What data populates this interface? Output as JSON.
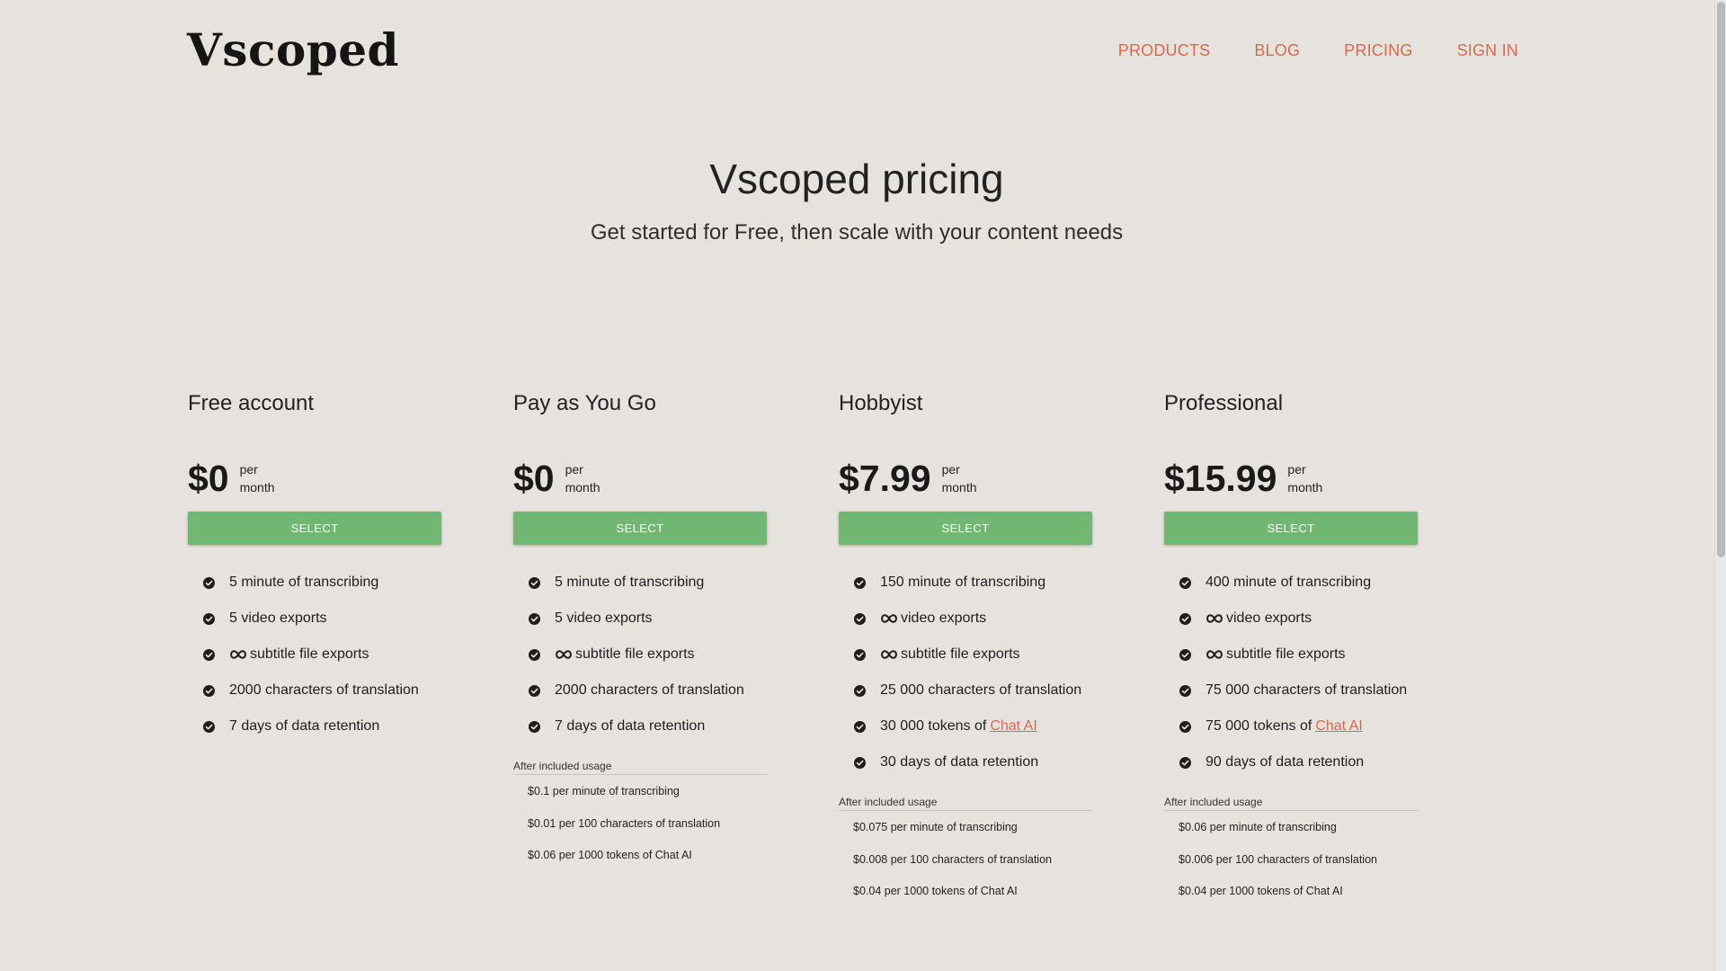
{
  "header": {
    "logo": "Vscoped",
    "nav": [
      "PRODUCTS",
      "BLOG",
      "PRICING",
      "SIGN IN"
    ]
  },
  "hero": {
    "title": "Vscoped pricing",
    "subtitle": "Get started for Free, then scale with your content needs"
  },
  "plans": [
    {
      "name": "Free account",
      "price": "$0",
      "per_1": "per",
      "per_2": "month",
      "select": "SELECT",
      "features": [
        {
          "text": "5 minute of transcribing"
        },
        {
          "text": "5 video exports"
        },
        {
          "text": "subtitle file exports",
          "infinity": true
        },
        {
          "text": "2000 characters of translation"
        },
        {
          "text": "7 days of data retention"
        }
      ]
    },
    {
      "name": "Pay as You Go",
      "price": "$0",
      "per_1": "per",
      "per_2": "month",
      "select": "SELECT",
      "features": [
        {
          "text": "5 minute of transcribing"
        },
        {
          "text": "5 video exports"
        },
        {
          "text": "subtitle file exports",
          "infinity": true
        },
        {
          "text": "2000 characters of translation"
        },
        {
          "text": "7 days of data retention"
        }
      ],
      "after_heading": "After included usage",
      "after": [
        "$0.1 per minute of transcribing",
        "$0.01 per 100 characters of translation",
        "$0.06 per 1000 tokens of Chat AI"
      ]
    },
    {
      "name": "Hobbyist",
      "price": "$7.99",
      "per_1": "per",
      "per_2": "month",
      "select": "SELECT",
      "features": [
        {
          "text": "150 minute of transcribing"
        },
        {
          "text": "video exports",
          "infinity": true
        },
        {
          "text": "subtitle file exports",
          "infinity": true
        },
        {
          "text": "25 000 characters of translation"
        },
        {
          "text": "30 000 tokens of",
          "link": "Chat AI"
        },
        {
          "text": "30 days of data retention"
        }
      ],
      "after_heading": "After included usage",
      "after": [
        "$0.075 per minute of transcribing",
        "$0.008 per 100 characters of translation",
        "$0.04 per 1000 tokens of Chat AI"
      ]
    },
    {
      "name": "Professional",
      "price": "$15.99",
      "per_1": "per",
      "per_2": "month",
      "select": "SELECT",
      "features": [
        {
          "text": "400 minute of transcribing"
        },
        {
          "text": "video exports",
          "infinity": true
        },
        {
          "text": "subtitle file exports",
          "infinity": true
        },
        {
          "text": "75 000 characters of translation"
        },
        {
          "text": "75 000 tokens of",
          "link": "Chat AI"
        },
        {
          "text": "90 days of data retention"
        }
      ],
      "after_heading": "After included usage",
      "after": [
        "$0.06 per minute of transcribing",
        "$0.006 per 100 characters of translation",
        "$0.04 per 1000 tokens of Chat AI"
      ]
    }
  ],
  "colors": {
    "background": "#e6e3df",
    "nav": "#d9694c",
    "button": "#71b773",
    "link": "#d9694c"
  },
  "icons": {
    "feature": "check-circle-icon",
    "unlimited": "infinity-icon"
  }
}
